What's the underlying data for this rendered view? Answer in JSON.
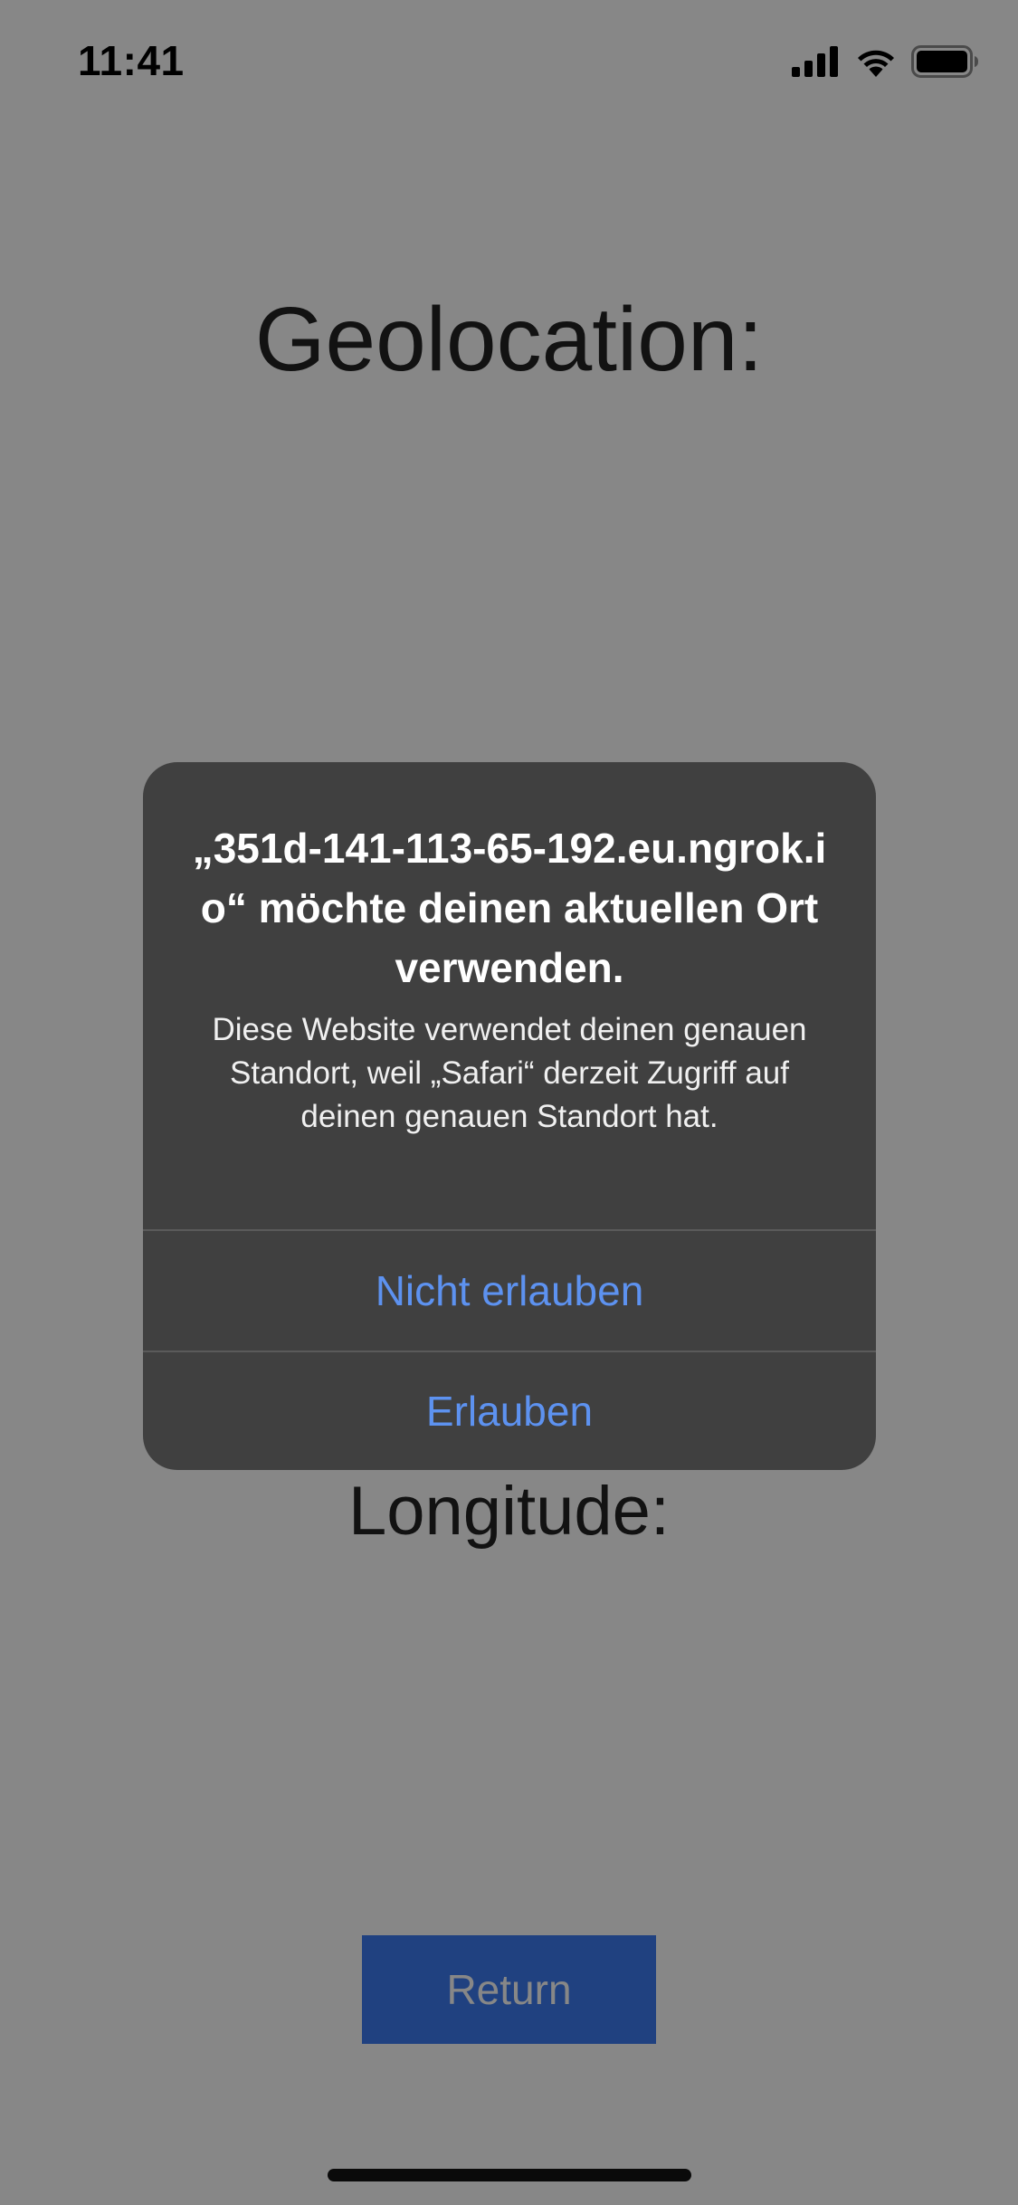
{
  "status_bar": {
    "time": "11:41",
    "icons": [
      "cellular-signal-icon",
      "wifi-icon",
      "battery-icon"
    ]
  },
  "page": {
    "title": "Geolocation:",
    "longitude_label": "Longitude:",
    "return_button": "Return"
  },
  "alert": {
    "title": "„351d-141-113-65-192.eu.ngrok.io“ möchte deinen aktuellen Ort verwenden.",
    "message": "Diese Website verwendet deinen genauen Standort, weil „Safari“ derzeit Zugriff auf deinen genauen Standort hat.",
    "deny_label": "Nicht erlauben",
    "allow_label": "Erlauben"
  },
  "colors": {
    "accent_blue": "#5d92f0",
    "button_blue": "#3d7cf2",
    "alert_background": "#404040"
  }
}
